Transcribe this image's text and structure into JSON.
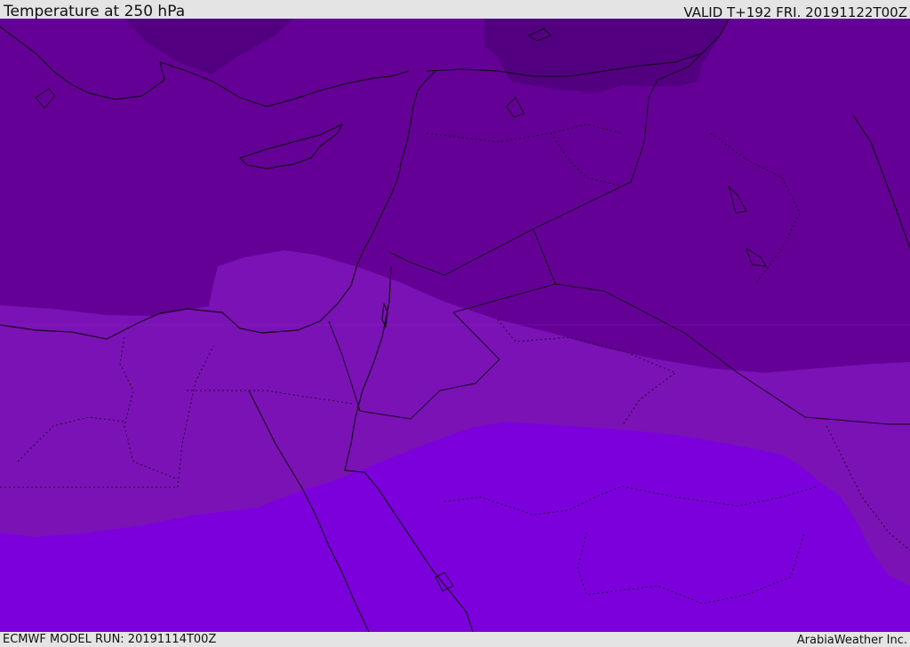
{
  "header": {
    "title": "Temperature at 250 hPa",
    "valid": "VALID T+192 FRI. 20191122T00Z"
  },
  "footer": {
    "model_run": "ECMWF MODEL RUN: 20191114T00Z",
    "credit": "ArabiaWeather Inc."
  },
  "map": {
    "colors": {
      "coldest": "#520080",
      "cold": "#650096",
      "mid": "#7a12b6",
      "warm": "#7c00dc",
      "boundary": "#1a0024"
    }
  }
}
